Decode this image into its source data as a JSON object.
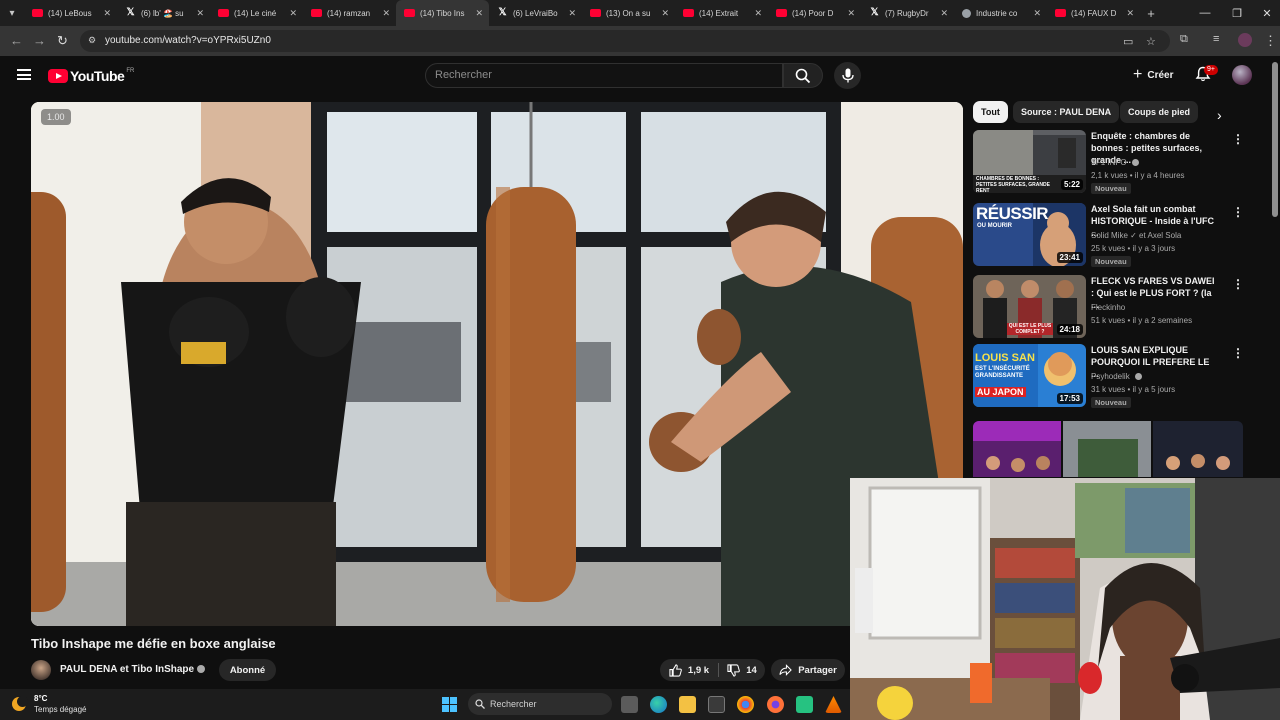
{
  "browser": {
    "tabs": [
      {
        "label": "(14) LeBous",
        "icon": "youtube-icon"
      },
      {
        "label": "(6) lb' 🏖️ su",
        "icon": "x-icon"
      },
      {
        "label": "(14) Le ciné",
        "icon": "youtube-icon"
      },
      {
        "label": "(14) ramzan",
        "icon": "youtube-icon"
      },
      {
        "label": "(14) Tibo Ins",
        "icon": "youtube-icon",
        "active": true
      },
      {
        "label": "(6) LeVraiBo",
        "icon": "x-icon"
      },
      {
        "label": "(13) On a su",
        "icon": "youtube-icon"
      },
      {
        "label": "(14) Extrait",
        "icon": "youtube-icon"
      },
      {
        "label": "(14) Poor D",
        "icon": "youtube-icon"
      },
      {
        "label": "(7) RugbyDr",
        "icon": "x-icon"
      },
      {
        "label": "Industrie co",
        "icon": "globe-icon"
      },
      {
        "label": "(14) FAUX D",
        "icon": "youtube-icon"
      }
    ],
    "url": "youtube.com/watch?v=oYPRxi5UZn0"
  },
  "header": {
    "logo_text": "YouTube",
    "country": "FR",
    "search_placeholder": "Rechercher",
    "create_label": "Créer",
    "notification_count": "9+"
  },
  "player": {
    "speed": "1.00"
  },
  "video": {
    "title": "Tibo Inshape me défie en boxe anglaise",
    "channel": "PAUL DENA et Tibo InShape",
    "subscribe_label": "Abonné",
    "likes": "1,9 k",
    "dislikes": "14",
    "share_label": "Partager"
  },
  "chips": [
    "Tout",
    "Source : PAUL DENA",
    "Coups de pied"
  ],
  "recommendations": [
    {
      "title": "Enquête : chambres de bonnes : petites surfaces, grande ...",
      "channel": "TF1 INFO",
      "meta": "2,1 k vues • il y a 4 heures",
      "duration": "5:22",
      "badge": "Nouveau",
      "thumb_text": "CHAMBRES DE BONNES : PETITES SURFACES, GRANDE RENT"
    },
    {
      "title": "Axel Sola fait un combat HISTORIQUE - Inside à l'UFC ...",
      "channel": "Solid Mike ✓ et Axel Sola",
      "meta": "25 k vues • il y a 3 jours",
      "duration": "23:41",
      "badge": "Nouveau",
      "thumb_text": "RÉUSSIR",
      "thumb_sub": "OU MOURIR"
    },
    {
      "title": "FLECK VS FARES VS DAWEI : Qui est le PLUS FORT ? (la ...",
      "channel": "Fleckinho",
      "meta": "51 k vues • il y a 2 semaines",
      "duration": "24:18",
      "badge": "",
      "thumb_text": "QUI EST LE PLUS COMPLET ?"
    },
    {
      "title": "LOUIS SAN EXPLIQUE POURQUOI IL PREFERE LE ...",
      "channel": "Psyhodelik",
      "meta": "31 k vues • il y a 5 jours",
      "duration": "17:53",
      "badge": "Nouveau",
      "thumb_text": "LOUIS SAN",
      "thumb_sub": "EST L'INSÉCURITÉ GRANDISSANTE",
      "thumb_sub2": "AU JAPON"
    }
  ],
  "taskbar": {
    "temperature": "8°C",
    "weather": "Temps dégagé",
    "search_label": "Rechercher"
  },
  "colors": {
    "youtube_red": "#ff0033",
    "background": "#0f0f0f",
    "chip_bg": "#272727"
  }
}
